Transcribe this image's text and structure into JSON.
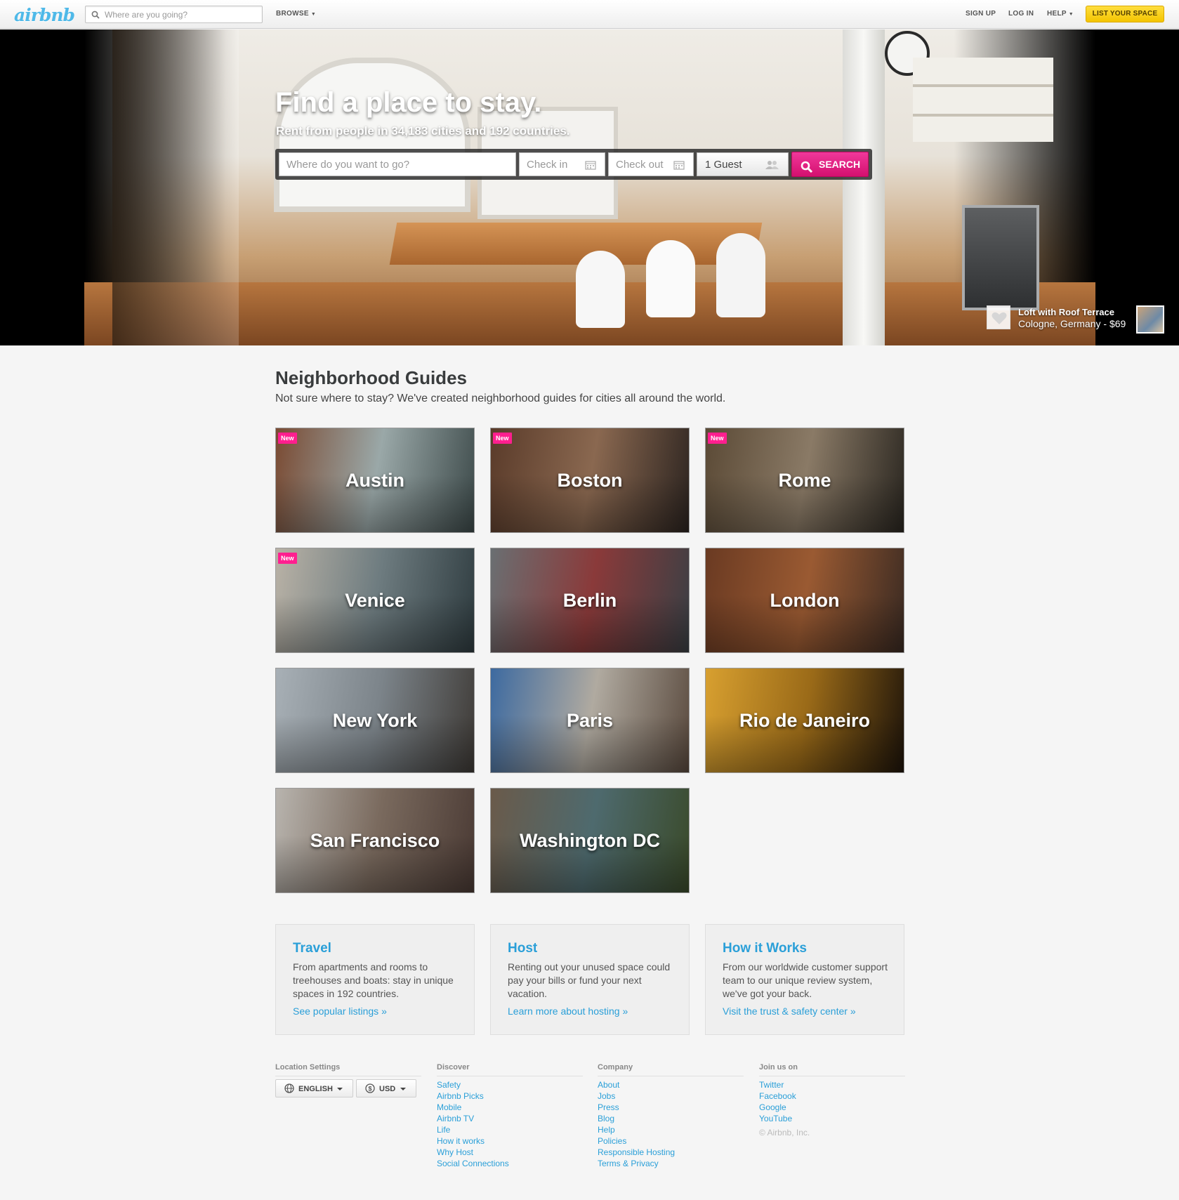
{
  "header": {
    "logo": "airbnb",
    "search_placeholder": "Where are you going?",
    "browse_label": "BROWSE",
    "sign_up": "SIGN UP",
    "log_in": "LOG IN",
    "help": "HELP",
    "list_space": "LIST YOUR SPACE"
  },
  "hero": {
    "title": "Find a place to stay.",
    "subtitle": "Rent from people in 34,183 cities and 192 countries.",
    "search": {
      "where_placeholder": "Where do you want to go?",
      "checkin_placeholder": "Check in",
      "checkout_placeholder": "Check out",
      "guests_value": "1 Guest",
      "search_button": "SEARCH"
    },
    "listing": {
      "name": "Loft with Roof Terrace",
      "meta": "Cologne, Germany - $69"
    }
  },
  "guides": {
    "title": "Neighborhood Guides",
    "subtitle": "Not sure where to stay? We've created neighborhood guides for cities all around the world.",
    "new_badge": "New",
    "cities": [
      {
        "name": "Austin",
        "is_new": true,
        "colors": [
          "#7a4a32",
          "#9aa8a8",
          "#3d4a4a"
        ]
      },
      {
        "name": "Boston",
        "is_new": true,
        "colors": [
          "#5a3b2a",
          "#8a6850",
          "#2c2420"
        ]
      },
      {
        "name": "Rome",
        "is_new": true,
        "colors": [
          "#5b4a36",
          "#8a7a66",
          "#2a2620"
        ]
      },
      {
        "name": "Venice",
        "is_new": true,
        "colors": [
          "#b9b2a6",
          "#6e7c80",
          "#2f3c40"
        ]
      },
      {
        "name": "Berlin",
        "is_new": false,
        "colors": [
          "#6a6f72",
          "#8a3a3a",
          "#3a3f44"
        ]
      },
      {
        "name": "London",
        "is_new": false,
        "colors": [
          "#6a3a22",
          "#9a5a32",
          "#3a2a22"
        ]
      },
      {
        "name": "New York",
        "is_new": false,
        "colors": [
          "#a8b0b6",
          "#7c848a",
          "#3e3a36"
        ]
      },
      {
        "name": "Paris",
        "is_new": false,
        "colors": [
          "#3d6aa0",
          "#b0aaa0",
          "#5a4a3e"
        ]
      },
      {
        "name": "Rio de Janeiro",
        "is_new": false,
        "colors": [
          "#d8a030",
          "#9a6a18",
          "#1e140a"
        ]
      },
      {
        "name": "San Francisco",
        "is_new": false,
        "colors": [
          "#b8b4ae",
          "#7a6a5e",
          "#4a3a34"
        ]
      },
      {
        "name": "Washington DC",
        "is_new": false,
        "colors": [
          "#6a5a4a",
          "#4e6a6e",
          "#3a4a2a"
        ]
      }
    ]
  },
  "info_boxes": [
    {
      "title": "Travel",
      "text": "From apartments and rooms to treehouses and boats: stay in unique spaces in 192 countries.",
      "link": "See popular listings »"
    },
    {
      "title": "Host",
      "text": "Renting out your unused space could pay your bills or fund your next vacation.",
      "link": "Learn more about hosting »"
    },
    {
      "title": "How it Works",
      "text": "From our worldwide customer support team to our unique review system, we've got your back.",
      "link": "Visit the trust & safety center »"
    }
  ],
  "footer": {
    "location_heading": "Location Settings",
    "language": "ENGLISH",
    "currency": "USD",
    "discover_heading": "Discover",
    "discover_links": [
      "Safety",
      "Airbnb Picks",
      "Mobile",
      "Airbnb TV",
      "Life",
      "How it works",
      "Why Host",
      "Social Connections"
    ],
    "company_heading": "Company",
    "company_links": [
      "About",
      "Jobs",
      "Press",
      "Blog",
      "Help",
      "Policies",
      "Responsible Hosting",
      "Terms & Privacy"
    ],
    "join_heading": "Join us on",
    "join_links": [
      "Twitter",
      "Facebook",
      "Google",
      "YouTube"
    ],
    "copyright": "© Airbnb, Inc."
  },
  "colors": {
    "brand_blue": "#2a9fd8",
    "search_pink": "#e0157c",
    "new_badge": "#ff1f8f",
    "cta_yellow": "#f3c400"
  }
}
